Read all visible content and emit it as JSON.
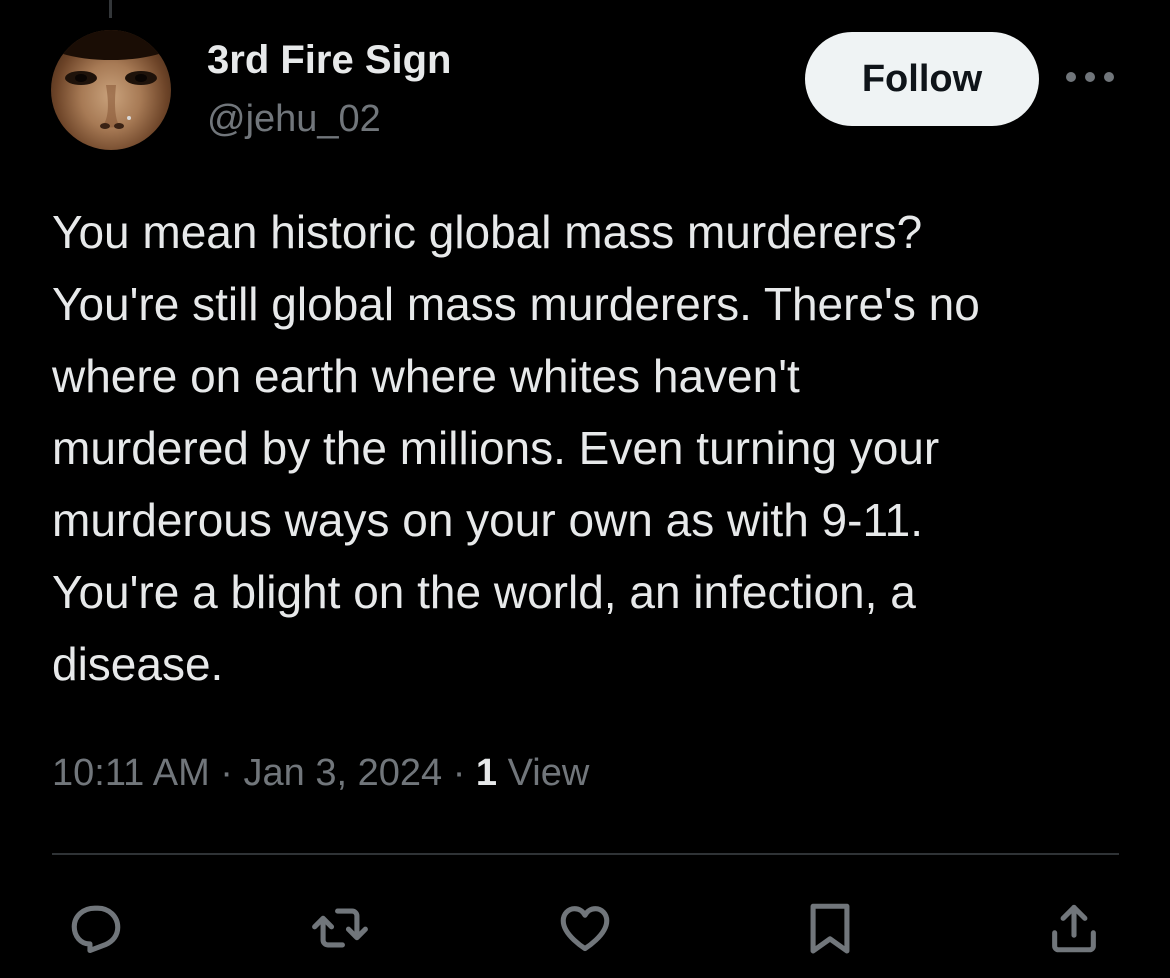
{
  "author": {
    "name": "3rd Fire Sign",
    "handle": "@jehu_02"
  },
  "header": {
    "follow_label": "Follow"
  },
  "tweet": {
    "text": "You mean historic global mass murderers?\nYou're still global mass murderers. There's no\nwhere on earth where whites haven't\nmurdered by the millions. Even turning your\nmurderous ways on your own as with 9-11.\nYou're a blight on the world, an infection, a\ndisease.",
    "time": "10:11 AM",
    "separator": "·",
    "date": "Jan 3, 2024",
    "views_count": "1",
    "views_label": "View"
  },
  "icons": {
    "more": "more-horizontal-icon",
    "reply": "reply-icon",
    "retweet": "retweet-icon",
    "like": "like-icon",
    "bookmark": "bookmark-icon",
    "share": "share-icon"
  },
  "colors": {
    "background": "#000000",
    "primary_text": "#e7e9ea",
    "secondary_text": "#71767b",
    "follow_bg": "#eff3f4",
    "follow_text": "#0f1419",
    "divider": "#2f3336"
  }
}
